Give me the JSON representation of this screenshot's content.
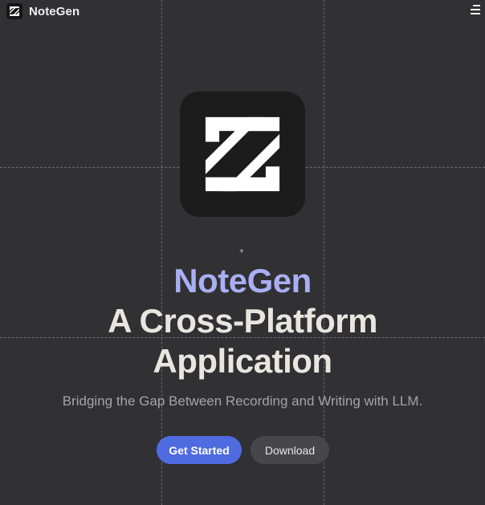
{
  "header": {
    "brand_name": "NoteGen",
    "logo_icon": "notegen-logo-icon",
    "menu_icon": "hamburger-menu-icon"
  },
  "hero": {
    "logo_icon": "notegen-logo-icon",
    "title_brand": "NoteGen",
    "title_line_1": "A Cross-Platform",
    "title_line_2": "Application",
    "subtitle": "Bridging the Gap Between Recording and Writing with LLM.",
    "marker": "+"
  },
  "actions": {
    "primary_label": "Get Started",
    "secondary_label": "Download"
  },
  "colors": {
    "background": "#313033",
    "brand_accent": "#a9aff3",
    "primary_button": "#4f6be0",
    "secondary_button": "#47464b"
  }
}
